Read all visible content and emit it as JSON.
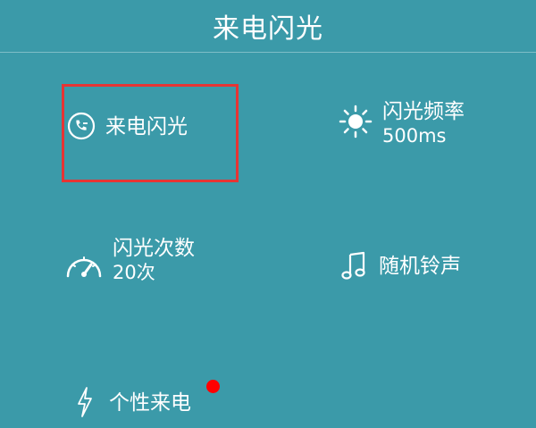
{
  "header": {
    "title": "来电闪光"
  },
  "tiles": {
    "incoming_flash": {
      "label": "来电闪光",
      "icon": "phone-incoming-icon"
    },
    "flash_frequency": {
      "label": "闪光频率",
      "value": "500ms",
      "icon": "sun-icon"
    },
    "flash_count": {
      "label": "闪光次数",
      "value": "20次",
      "icon": "speedometer-icon"
    },
    "random_ringtone": {
      "label": "随机铃声",
      "icon": "music-note-icon"
    },
    "custom_incoming": {
      "label": "个性来电",
      "icon": "lightning-icon",
      "badge_color": "#ff0000"
    }
  },
  "colors": {
    "background": "#3b9aa9",
    "highlight_border": "#e63434",
    "text": "#ffffff"
  }
}
